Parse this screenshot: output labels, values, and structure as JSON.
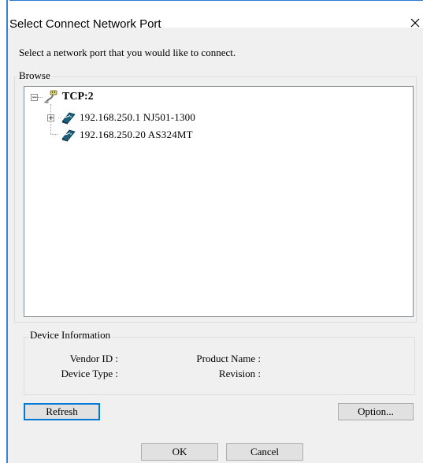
{
  "dialog": {
    "title": "Select Connect Network Port",
    "instruction": "Select a network port that you would like to connect."
  },
  "browse": {
    "legend": "Browse",
    "tree": {
      "root": {
        "label": "TCP:2",
        "expanded": true,
        "icon": "network-port-icon"
      },
      "children": [
        {
          "label": "192.168.250.1 NJ501-1300",
          "expandable": true,
          "icon": "device-icon"
        },
        {
          "label": "192.168.250.20 AS324MT",
          "expandable": false,
          "icon": "device-icon"
        }
      ]
    }
  },
  "device_info": {
    "legend": "Device Information",
    "vendor_id_label": "Vendor ID :",
    "device_type_label": "Device Type :",
    "product_name_label": "Product Name :",
    "revision_label": "Revision :"
  },
  "buttons": {
    "refresh": "Refresh",
    "option": "Option...",
    "ok": "OK",
    "cancel": "Cancel"
  },
  "colors": {
    "accent": "#0078d7",
    "dialog_bg": "#f0f0f0",
    "device_icon_blue": "#1c5f7a"
  }
}
